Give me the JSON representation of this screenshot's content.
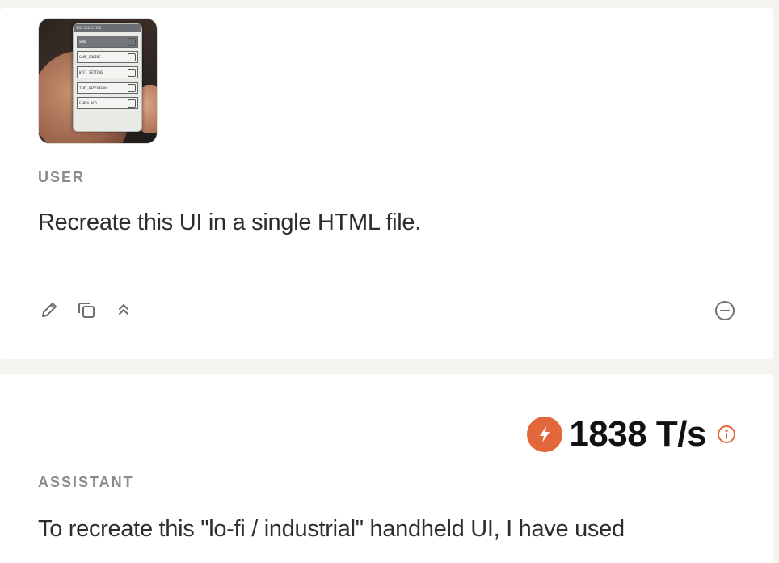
{
  "user_message": {
    "role_label": "USER",
    "text": "Recreate this UI in a single HTML file.",
    "attachment": {
      "type": "image",
      "device_status": "192.168.2.176",
      "device_menu": [
        "SOUL",
        "GAME_ENGINE",
        "WIFI_SETTING",
        "TINY_DIFFUSION",
        "FARKA.ACD"
      ]
    },
    "actions": [
      "edit-icon",
      "copy-icon",
      "collapse-icon",
      "remove-icon"
    ]
  },
  "assistant_message": {
    "role_label": "ASSISTANT",
    "speed_value": "1838 T/s",
    "speed_icon": "bolt-icon",
    "text": "To recreate this \"lo-fi / industrial\" handheld UI, I have used"
  },
  "colors": {
    "page_bg": "#f4f3ef",
    "card_bg": "#ffffff",
    "accent": "#e2673a",
    "label": "#8a8a8a",
    "text": "#2e2e2e"
  }
}
